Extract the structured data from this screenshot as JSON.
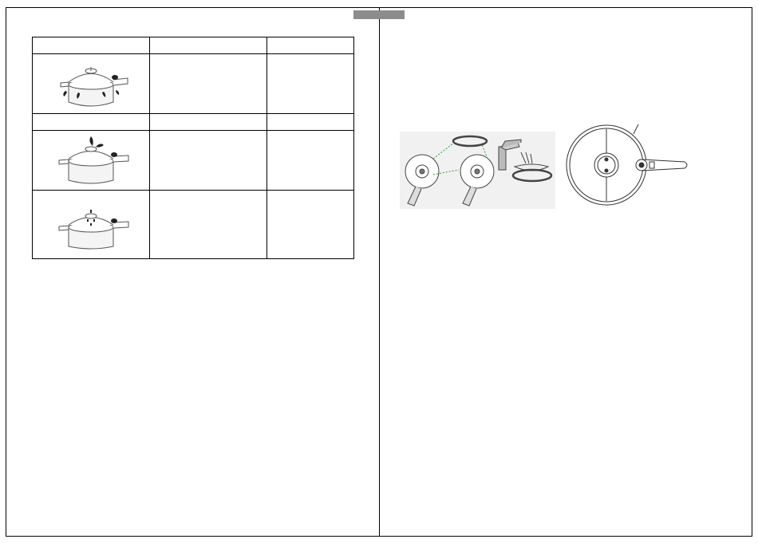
{
  "manual": {
    "table": {
      "header": [
        "",
        "",
        ""
      ],
      "rows": [
        {
          "figure": "pressure-cooker-steam-escaping-under-lid-icon",
          "cause": "",
          "solution": ""
        },
        {
          "subheader": [
            "",
            "",
            ""
          ]
        },
        {
          "figure": "pressure-cooker-steam-from-valve-icon",
          "cause": "",
          "solution": ""
        },
        {
          "figure": "pressure-cooker-steam-from-safety-window-icon",
          "cause": "",
          "solution": ""
        }
      ]
    },
    "figures": {
      "gasket_cleaning": "gasket-removal-and-washing-illustration",
      "lid_top_view": "lid-top-view-illustration"
    },
    "colors": {
      "tab": "#8c8c8c",
      "figure_background": "#f1f1f1",
      "leader_line": "#2e9c3a"
    }
  }
}
